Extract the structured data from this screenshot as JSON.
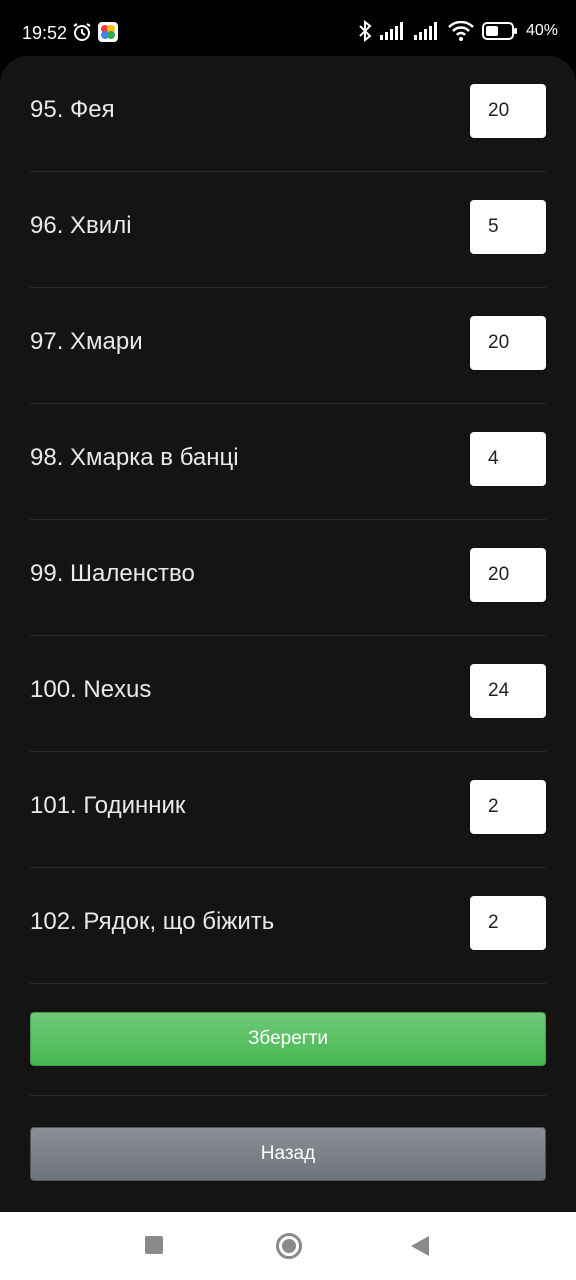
{
  "status_bar": {
    "time": "19:52",
    "battery": "40%",
    "icons": [
      "alarm-icon",
      "photos-icon",
      "bluetooth-icon",
      "signal-icon",
      "signal-icon",
      "wifi-icon",
      "battery-icon"
    ]
  },
  "items": [
    {
      "label": "95. Фея",
      "value": "20"
    },
    {
      "label": "96. Хвилі",
      "value": "5"
    },
    {
      "label": "97. Хмари",
      "value": "20"
    },
    {
      "label": "98. Хмарка в банці",
      "value": "4"
    },
    {
      "label": "99. Шаленство",
      "value": "20"
    },
    {
      "label": "100. Nexus",
      "value": "24"
    },
    {
      "label": "101. Годинник",
      "value": "2"
    },
    {
      "label": "102. Рядок, що біжить",
      "value": "2"
    }
  ],
  "buttons": {
    "save": "Зберегти",
    "back": "Назад"
  },
  "colors": {
    "background": "#141414",
    "save": "#5cc265",
    "back": "#7b8187"
  }
}
